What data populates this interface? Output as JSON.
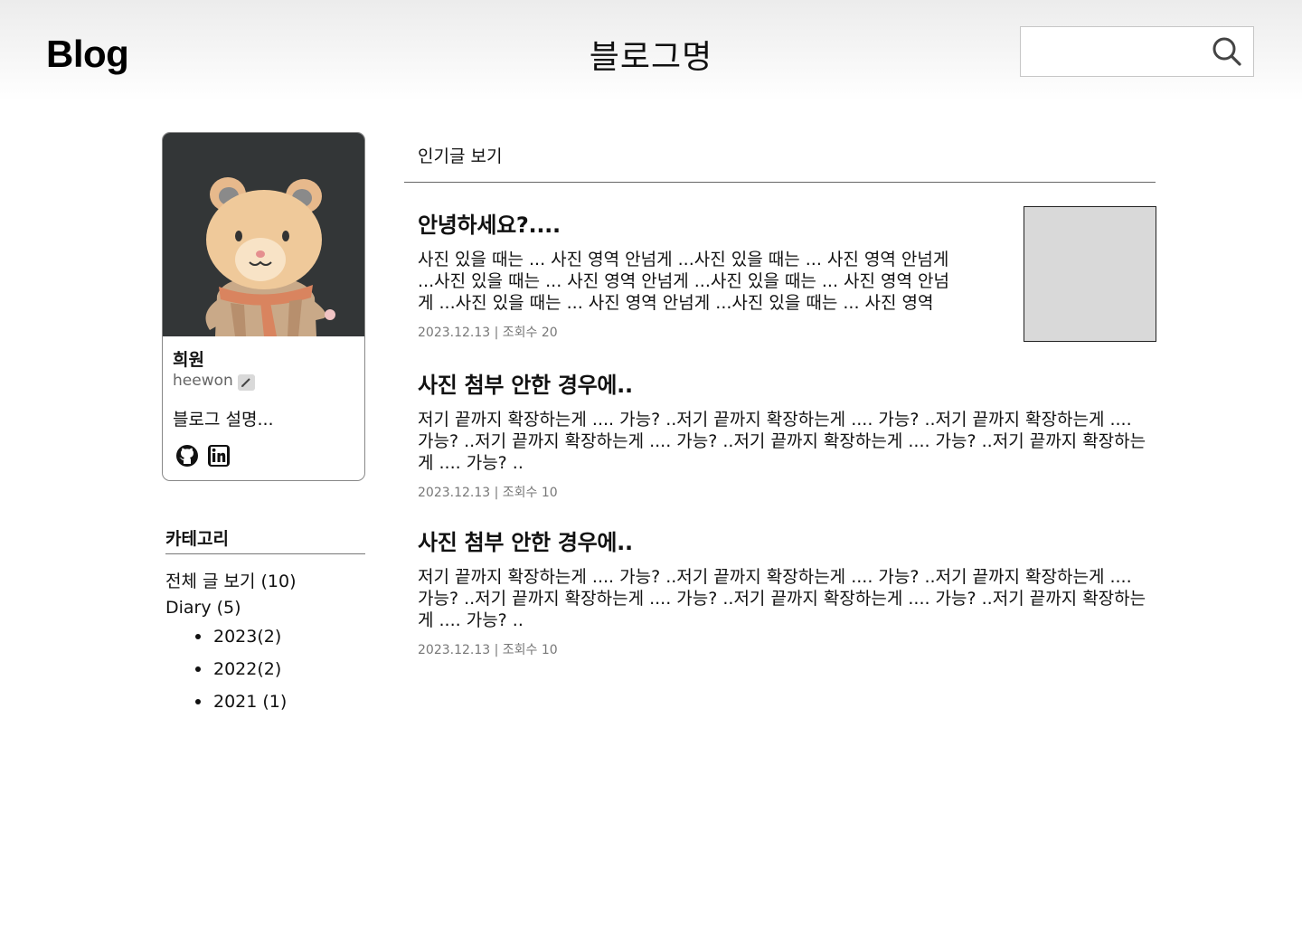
{
  "header": {
    "logo": "Blog",
    "blog_name": "블로그명",
    "search": {
      "placeholder": "",
      "value": ""
    }
  },
  "profile": {
    "name": "희원",
    "handle": "heewon",
    "description": "블로그 설명..."
  },
  "category": {
    "title": "카테고리",
    "all": "전체 글 보기 (10)",
    "diary": "Diary (5)",
    "sub_items": [
      "2023(2)",
      "2022(2)",
      "2021 (1)"
    ]
  },
  "main": {
    "popular_link": "인기글 보기",
    "posts": [
      {
        "title": "안녕하세요?....",
        "excerpt": "사진 있을 때는 ... 사진 영역 안넘게 ...사진 있을 때는 ... 사진 영역 안넘게 ...사진 있을 때는 ... 사진 영역 안넘게 ...사진 있을 때는 ... 사진 영역 안넘게 ...사진 있을 때는 ... 사진 영역 안넘게 ...사진 있을 때는 ... 사진 영역",
        "meta": "2023.12.13 | 조회수 20"
      },
      {
        "title": "사진 첨부 안한 경우에..",
        "excerpt": "저기 끝까지 확장하는게 .... 가능? ..저기 끝까지 확장하는게 .... 가능? ..저기 끝까지 확장하는게 .... 가능? ..저기 끝까지 확장하는게 .... 가능? ..저기 끝까지 확장하는게 .... 가능? ..저기 끝까지 확장하는게 .... 가능? ..",
        "meta": "2023.12.13 | 조회수 10"
      },
      {
        "title": "사진 첨부 안한 경우에..",
        "excerpt": "저기 끝까지 확장하는게 .... 가능? ..저기 끝까지 확장하는게 .... 가능? ..저기 끝까지 확장하는게 .... 가능? ..저기 끝까지 확장하는게 .... 가능? ..저기 끝까지 확장하는게 .... 가능? ..저기 끝까지 확장하는게 .... 가능? ..",
        "meta": "2023.12.13 | 조회수 10"
      }
    ]
  },
  "icons": {
    "search": "search-icon",
    "edit": "pencil-icon",
    "github": "github-icon",
    "linkedin": "linkedin-icon"
  },
  "colors": {
    "avatar_bg": "#333637",
    "thumb_bg": "#d9d9d9",
    "meta_text": "#777777"
  }
}
